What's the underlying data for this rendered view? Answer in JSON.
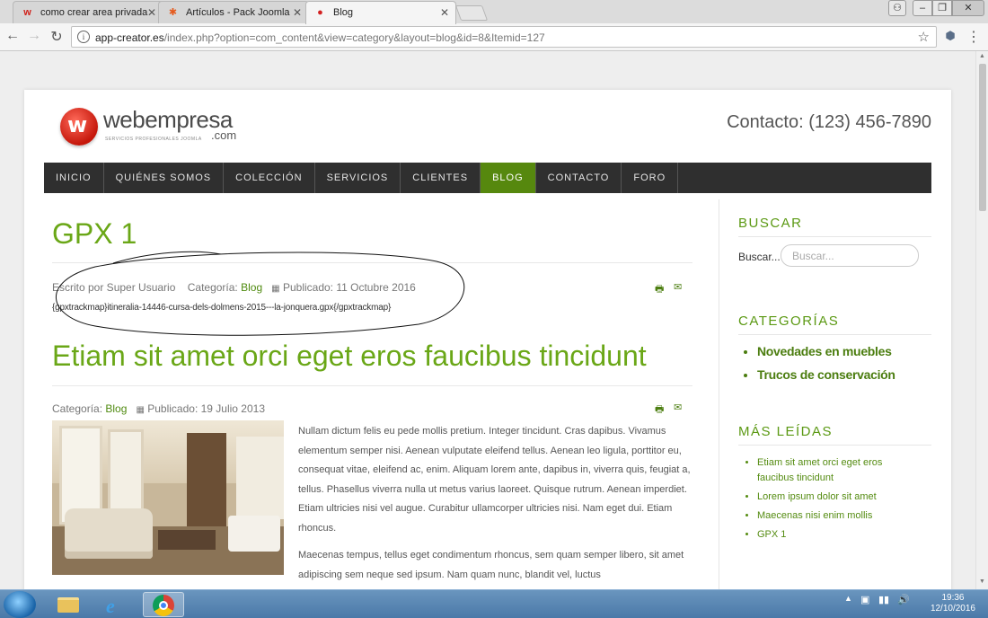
{
  "browser": {
    "tabs": [
      {
        "label": "como crear area privada",
        "icon": "webempresa-icon",
        "active": false
      },
      {
        "label": "Artículos - Pack Joomla",
        "icon": "joomla-icon",
        "active": false
      },
      {
        "label": "Blog",
        "icon": "drop-icon",
        "active": true
      }
    ],
    "url_host": "app-creator.es",
    "url_rest": "/index.php?option=com_content&view=category&layout=blog&id=8&Itemid=127"
  },
  "site": {
    "logo_word": "webempresa",
    "logo_com": ".com",
    "logo_sub": "SERVICIOS PROFESIONALES JOOMLA",
    "contact": "Contacto: (123) 456-7890",
    "nav": [
      "INICIO",
      "QUIÉNES SOMOS",
      "COLECCIÓN",
      "SERVICIOS",
      "CLIENTES",
      "BLOG",
      "CONTACTO",
      "FORO"
    ],
    "nav_active": "BLOG",
    "accent": "#6aa717"
  },
  "articles": [
    {
      "title": "GPX 1",
      "author": "Escrito por Super Usuario",
      "category_label": "Categoría:",
      "category": "Blog",
      "published": "Publicado: 11 Octubre 2016",
      "body": "{gpxtrackmap}itineralia-14446-cursa-dels-dolmens-2015---la-jonquera.gpx{/gpxtrackmap}"
    },
    {
      "title": "Etiam sit amet orci eget eros faucibus tincidunt",
      "category_label": "Categoría:",
      "category": "Blog",
      "published": "Publicado: 19 Julio 2013",
      "para1": "Nullam dictum felis eu pede mollis pretium. Integer tincidunt. Cras dapibus. Vivamus elementum semper nisi. Aenean vulputate eleifend tellus. Aenean leo ligula, porttitor eu, consequat vitae, eleifend ac, enim. Aliquam lorem ante, dapibus in, viverra quis, feugiat a, tellus. Phasellus viverra nulla ut metus varius laoreet. Quisque rutrum. Aenean imperdiet. Etiam ultricies nisi vel augue. Curabitur ullamcorper ultricies nisi. Nam eget dui. Etiam rhoncus.",
      "para2": "Maecenas tempus, tellus eget condimentum rhoncus, sem quam semper libero, sit amet adipiscing sem neque sed ipsum. Nam quam nunc, blandit vel, luctus"
    }
  ],
  "sidebar": {
    "search_title": "BUSCAR",
    "search_label": "Buscar...",
    "search_placeholder": "Buscar...",
    "categories_title": "CATEGORÍAS",
    "categories": [
      "Novedades en muebles",
      "Trucos de conservación"
    ],
    "most_read_title": "MÁS LEÍDAS",
    "most_read": [
      "Etiam sit amet orci eget eros faucibus tincidunt",
      "Lorem ipsum dolor sit amet",
      "Maecenas nisi enim mollis",
      "GPX 1"
    ]
  },
  "taskbar": {
    "time": "19:36",
    "date": "12/10/2016"
  }
}
